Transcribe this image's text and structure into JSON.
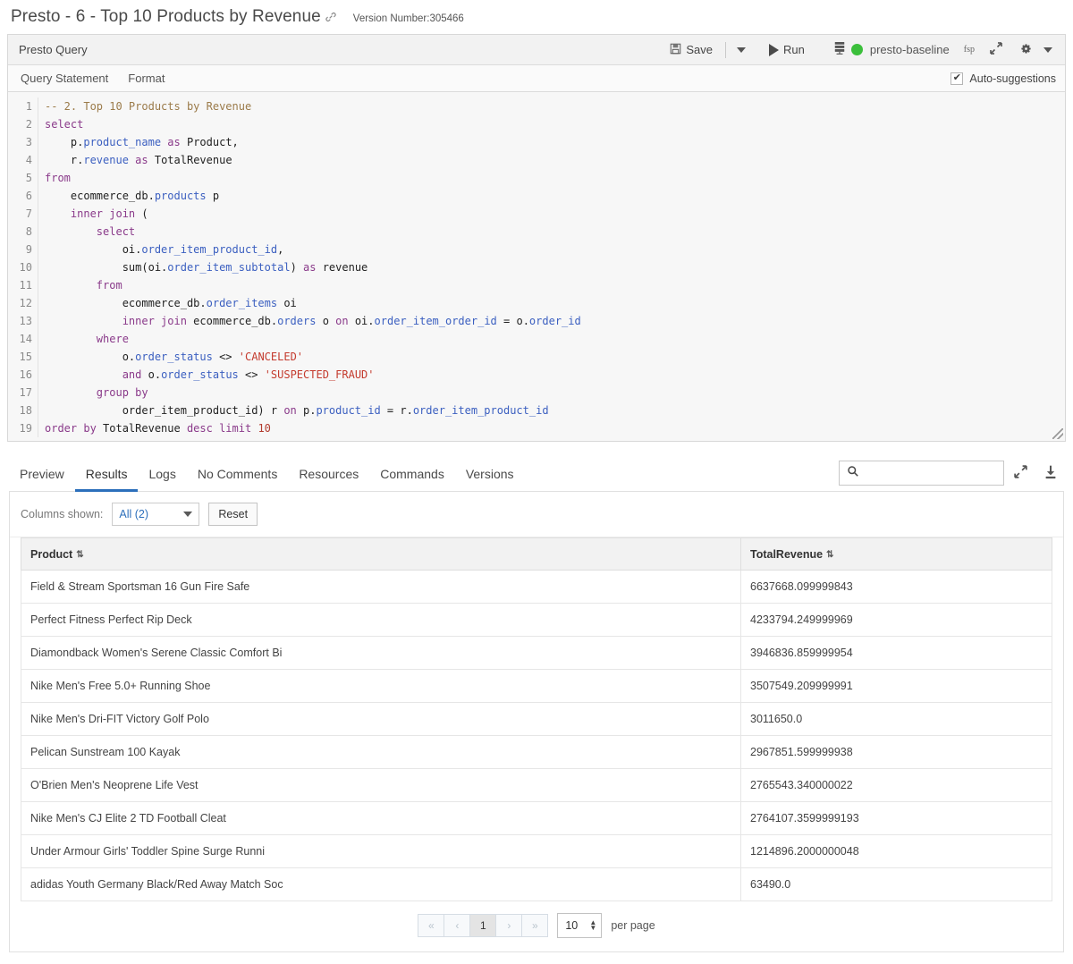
{
  "header": {
    "title": "Presto - 6 - Top 10 Products by Revenue",
    "link_icon": "link-icon",
    "version_label": "Version Number:305466"
  },
  "query_toolbar": {
    "panel_title": "Presto Query",
    "save_label": "Save",
    "save_icon": "save-disk-icon",
    "save_dropdown_icon": "chevron-down-icon",
    "run_label": "Run",
    "run_icon": "play-icon",
    "cluster_icon": "server-stack-icon",
    "status_icon": "status-dot-green",
    "status_color": "#3bbf3b",
    "cluster_name": "presto-baseline",
    "fsp_label": "fsp",
    "expand_icon": "expand-arrows-icon",
    "settings_icon": "gear-icon",
    "settings_dropdown_icon": "chevron-down-icon"
  },
  "editor_tabs": {
    "items": [
      {
        "label": "Query Statement"
      },
      {
        "label": "Format"
      }
    ],
    "auto_suggestions_label": "Auto-suggestions",
    "auto_suggestions_checked": true,
    "check_glyph": "✔"
  },
  "code": {
    "lines": [
      {
        "num": "1",
        "tokens": [
          {
            "t": "com",
            "s": "-- 2. Top 10 Products by Revenue"
          }
        ]
      },
      {
        "num": "2",
        "tokens": [
          {
            "t": "kw",
            "s": "select"
          }
        ]
      },
      {
        "num": "3",
        "tokens": [
          {
            "t": "pln",
            "s": "    p."
          },
          {
            "t": "id",
            "s": "product_name"
          },
          {
            "t": "pln",
            "s": " "
          },
          {
            "t": "kw",
            "s": "as"
          },
          {
            "t": "pln",
            "s": " Product,"
          }
        ]
      },
      {
        "num": "4",
        "tokens": [
          {
            "t": "pln",
            "s": "    r."
          },
          {
            "t": "id",
            "s": "revenue"
          },
          {
            "t": "pln",
            "s": " "
          },
          {
            "t": "kw",
            "s": "as"
          },
          {
            "t": "pln",
            "s": " TotalRevenue"
          }
        ]
      },
      {
        "num": "5",
        "tokens": [
          {
            "t": "kw",
            "s": "from"
          }
        ]
      },
      {
        "num": "6",
        "tokens": [
          {
            "t": "pln",
            "s": "    ecommerce_db."
          },
          {
            "t": "id",
            "s": "products"
          },
          {
            "t": "pln",
            "s": " p"
          }
        ]
      },
      {
        "num": "7",
        "tokens": [
          {
            "t": "pln",
            "s": "    "
          },
          {
            "t": "kw",
            "s": "inner join"
          },
          {
            "t": "pln",
            "s": " ("
          }
        ]
      },
      {
        "num": "8",
        "tokens": [
          {
            "t": "pln",
            "s": "        "
          },
          {
            "t": "kw",
            "s": "select"
          }
        ]
      },
      {
        "num": "9",
        "tokens": [
          {
            "t": "pln",
            "s": "            oi."
          },
          {
            "t": "id",
            "s": "order_item_product_id"
          },
          {
            "t": "pln",
            "s": ","
          }
        ]
      },
      {
        "num": "10",
        "tokens": [
          {
            "t": "pln",
            "s": "            sum(oi."
          },
          {
            "t": "id",
            "s": "order_item_subtotal"
          },
          {
            "t": "pln",
            "s": ") "
          },
          {
            "t": "kw",
            "s": "as"
          },
          {
            "t": "pln",
            "s": " revenue"
          }
        ]
      },
      {
        "num": "11",
        "tokens": [
          {
            "t": "pln",
            "s": "        "
          },
          {
            "t": "kw",
            "s": "from"
          }
        ]
      },
      {
        "num": "12",
        "tokens": [
          {
            "t": "pln",
            "s": "            ecommerce_db."
          },
          {
            "t": "id",
            "s": "order_items"
          },
          {
            "t": "pln",
            "s": " oi"
          }
        ]
      },
      {
        "num": "13",
        "tokens": [
          {
            "t": "pln",
            "s": "            "
          },
          {
            "t": "kw",
            "s": "inner join"
          },
          {
            "t": "pln",
            "s": " ecommerce_db."
          },
          {
            "t": "id",
            "s": "orders"
          },
          {
            "t": "pln",
            "s": " o "
          },
          {
            "t": "kw",
            "s": "on"
          },
          {
            "t": "pln",
            "s": " oi."
          },
          {
            "t": "id",
            "s": "order_item_order_id"
          },
          {
            "t": "pln",
            "s": " = o."
          },
          {
            "t": "id",
            "s": "order_id"
          }
        ]
      },
      {
        "num": "14",
        "tokens": [
          {
            "t": "pln",
            "s": "        "
          },
          {
            "t": "kw",
            "s": "where"
          }
        ]
      },
      {
        "num": "15",
        "tokens": [
          {
            "t": "pln",
            "s": "            o."
          },
          {
            "t": "id",
            "s": "order_status"
          },
          {
            "t": "pln",
            "s": " <> "
          },
          {
            "t": "str",
            "s": "'CANCELED'"
          }
        ]
      },
      {
        "num": "16",
        "tokens": [
          {
            "t": "pln",
            "s": "            "
          },
          {
            "t": "kw",
            "s": "and"
          },
          {
            "t": "pln",
            "s": " o."
          },
          {
            "t": "id",
            "s": "order_status"
          },
          {
            "t": "pln",
            "s": " <> "
          },
          {
            "t": "str",
            "s": "'SUSPECTED_FRAUD'"
          }
        ]
      },
      {
        "num": "17",
        "tokens": [
          {
            "t": "pln",
            "s": "        "
          },
          {
            "t": "kw",
            "s": "group by"
          }
        ]
      },
      {
        "num": "18",
        "tokens": [
          {
            "t": "pln",
            "s": "            order_item_product_id) r "
          },
          {
            "t": "kw",
            "s": "on"
          },
          {
            "t": "pln",
            "s": " p."
          },
          {
            "t": "id",
            "s": "product_id"
          },
          {
            "t": "pln",
            "s": " = r."
          },
          {
            "t": "id",
            "s": "order_item_product_id"
          }
        ]
      },
      {
        "num": "19",
        "tokens": [
          {
            "t": "kw",
            "s": "order by"
          },
          {
            "t": "pln",
            "s": " TotalRevenue "
          },
          {
            "t": "kw",
            "s": "desc limit"
          },
          {
            "t": "pln",
            "s": " "
          },
          {
            "t": "num",
            "s": "10"
          }
        ]
      }
    ]
  },
  "results": {
    "tabs": [
      {
        "label": "Preview",
        "active": false
      },
      {
        "label": "Results",
        "active": true
      },
      {
        "label": "Logs",
        "active": false
      },
      {
        "label": "No Comments",
        "active": false
      },
      {
        "label": "Resources",
        "active": false
      },
      {
        "label": "Commands",
        "active": false
      },
      {
        "label": "Versions",
        "active": false
      }
    ],
    "active_tab_color": "#2c6fbb",
    "search": {
      "value": "",
      "placeholder": "",
      "icon": "search-icon"
    },
    "expand_icon": "expand-arrows-icon",
    "download_icon": "download-icon",
    "columns_shown_label": "Columns shown:",
    "columns_select_value": "All (2)",
    "reset_label": "Reset",
    "table": {
      "headers": [
        "Product",
        "TotalRevenue"
      ],
      "sort_glyph": "⇅",
      "rows": [
        {
          "product": "Field & Stream Sportsman 16 Gun Fire Safe",
          "revenue": "6637668.099999843"
        },
        {
          "product": "Perfect Fitness Perfect Rip Deck",
          "revenue": "4233794.249999969"
        },
        {
          "product": "Diamondback Women's Serene Classic Comfort Bi",
          "revenue": "3946836.859999954"
        },
        {
          "product": "Nike Men's Free 5.0+ Running Shoe",
          "revenue": "3507549.209999991"
        },
        {
          "product": "Nike Men's Dri-FIT Victory Golf Polo",
          "revenue": "3011650.0"
        },
        {
          "product": "Pelican Sunstream 100 Kayak",
          "revenue": "2967851.599999938"
        },
        {
          "product": "O'Brien Men's Neoprene Life Vest",
          "revenue": "2765543.340000022"
        },
        {
          "product": "Nike Men's CJ Elite 2 TD Football Cleat",
          "revenue": "2764107.3599999193"
        },
        {
          "product": "Under Armour Girls' Toddler Spine Surge Runni",
          "revenue": "1214896.2000000048"
        },
        {
          "product": "adidas Youth Germany Black/Red Away Match Soc",
          "revenue": "63490.0"
        }
      ]
    },
    "pagination": {
      "first_label": "«",
      "prev_label": "‹",
      "current_page": "1",
      "next_label": "›",
      "last_label": "»",
      "per_page_value": "10",
      "per_page_label": "per page"
    }
  }
}
